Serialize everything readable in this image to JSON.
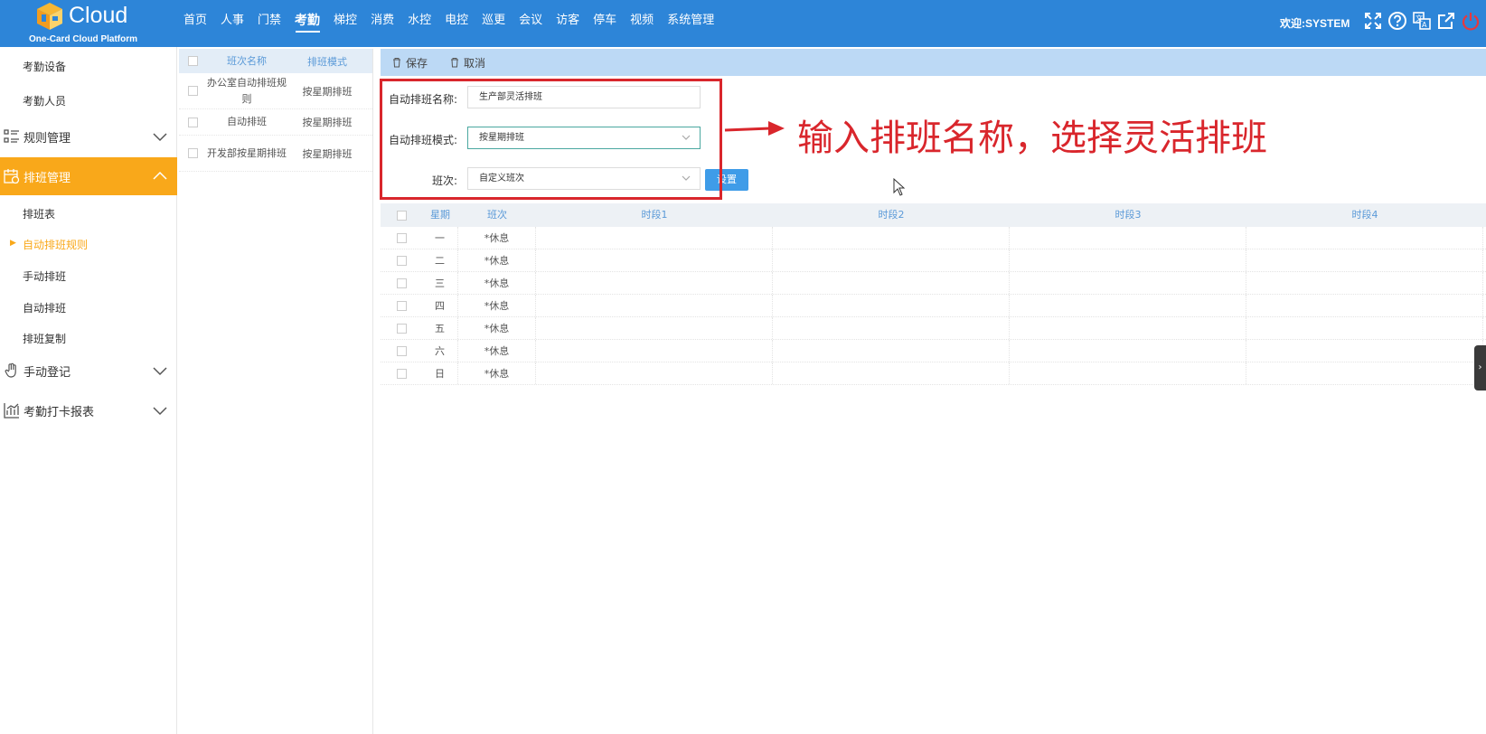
{
  "brand": {
    "name": "Cloud",
    "subtitle": "One-Card Cloud Platform"
  },
  "nav": [
    "首页",
    "人事",
    "门禁",
    "考勤",
    "梯控",
    "消费",
    "水控",
    "电控",
    "巡更",
    "会议",
    "访客",
    "停车",
    "视频",
    "系统管理"
  ],
  "nav_active": "考勤",
  "welcome": "欢迎:SYSTEM",
  "header_icons": [
    "fullscreen-icon",
    "help-icon",
    "language-icon",
    "external-link-icon",
    "power-icon"
  ],
  "sidebar": {
    "sub_top": [
      "考勤设备",
      "考勤人员"
    ],
    "group_rules": "规则管理",
    "group_schedule": "排班管理",
    "schedule_items": [
      "排班表",
      "自动排班规则",
      "手动排班",
      "自动排班",
      "排班复制"
    ],
    "schedule_active": "自动排班规则",
    "group_manual": "手动登记",
    "group_report": "考勤打卡报表"
  },
  "list_panel": {
    "headers": {
      "name": "班次名称",
      "mode": "排班模式"
    },
    "rows": [
      {
        "name": "办公室自动排班规则",
        "mode": "按星期排班"
      },
      {
        "name": "自动排班",
        "mode": "按星期排班"
      },
      {
        "name": "开发部按星期排班",
        "mode": "按星期排班"
      }
    ]
  },
  "toolbar": {
    "save": "保存",
    "cancel": "取消"
  },
  "form": {
    "name_label": "自动排班名称:",
    "name_value": "生产部灵活排班",
    "mode_label": "自动排班模式:",
    "mode_value": "按星期排班",
    "shift_label": "班次:",
    "shift_value": "自定义班次",
    "set_button": "设置"
  },
  "annotation": {
    "text": "输入排班名称，选择灵活排班",
    "color": "#d9262c"
  },
  "grid": {
    "headers": {
      "day": "星期",
      "shift": "班次",
      "seg1": "时段1",
      "seg2": "时段2",
      "seg3": "时段3",
      "seg4": "时段4"
    },
    "rows": [
      {
        "day": "一",
        "shift": "*休息"
      },
      {
        "day": "二",
        "shift": "*休息"
      },
      {
        "day": "三",
        "shift": "*休息"
      },
      {
        "day": "四",
        "shift": "*休息"
      },
      {
        "day": "五",
        "shift": "*休息"
      },
      {
        "day": "六",
        "shift": "*休息"
      },
      {
        "day": "日",
        "shift": "*休息"
      }
    ]
  },
  "colors": {
    "header_bg": "#2d85d8",
    "active_group": "#f9a81a",
    "toolbar_bg": "#bcd9f5",
    "button": "#3f9ce8"
  }
}
